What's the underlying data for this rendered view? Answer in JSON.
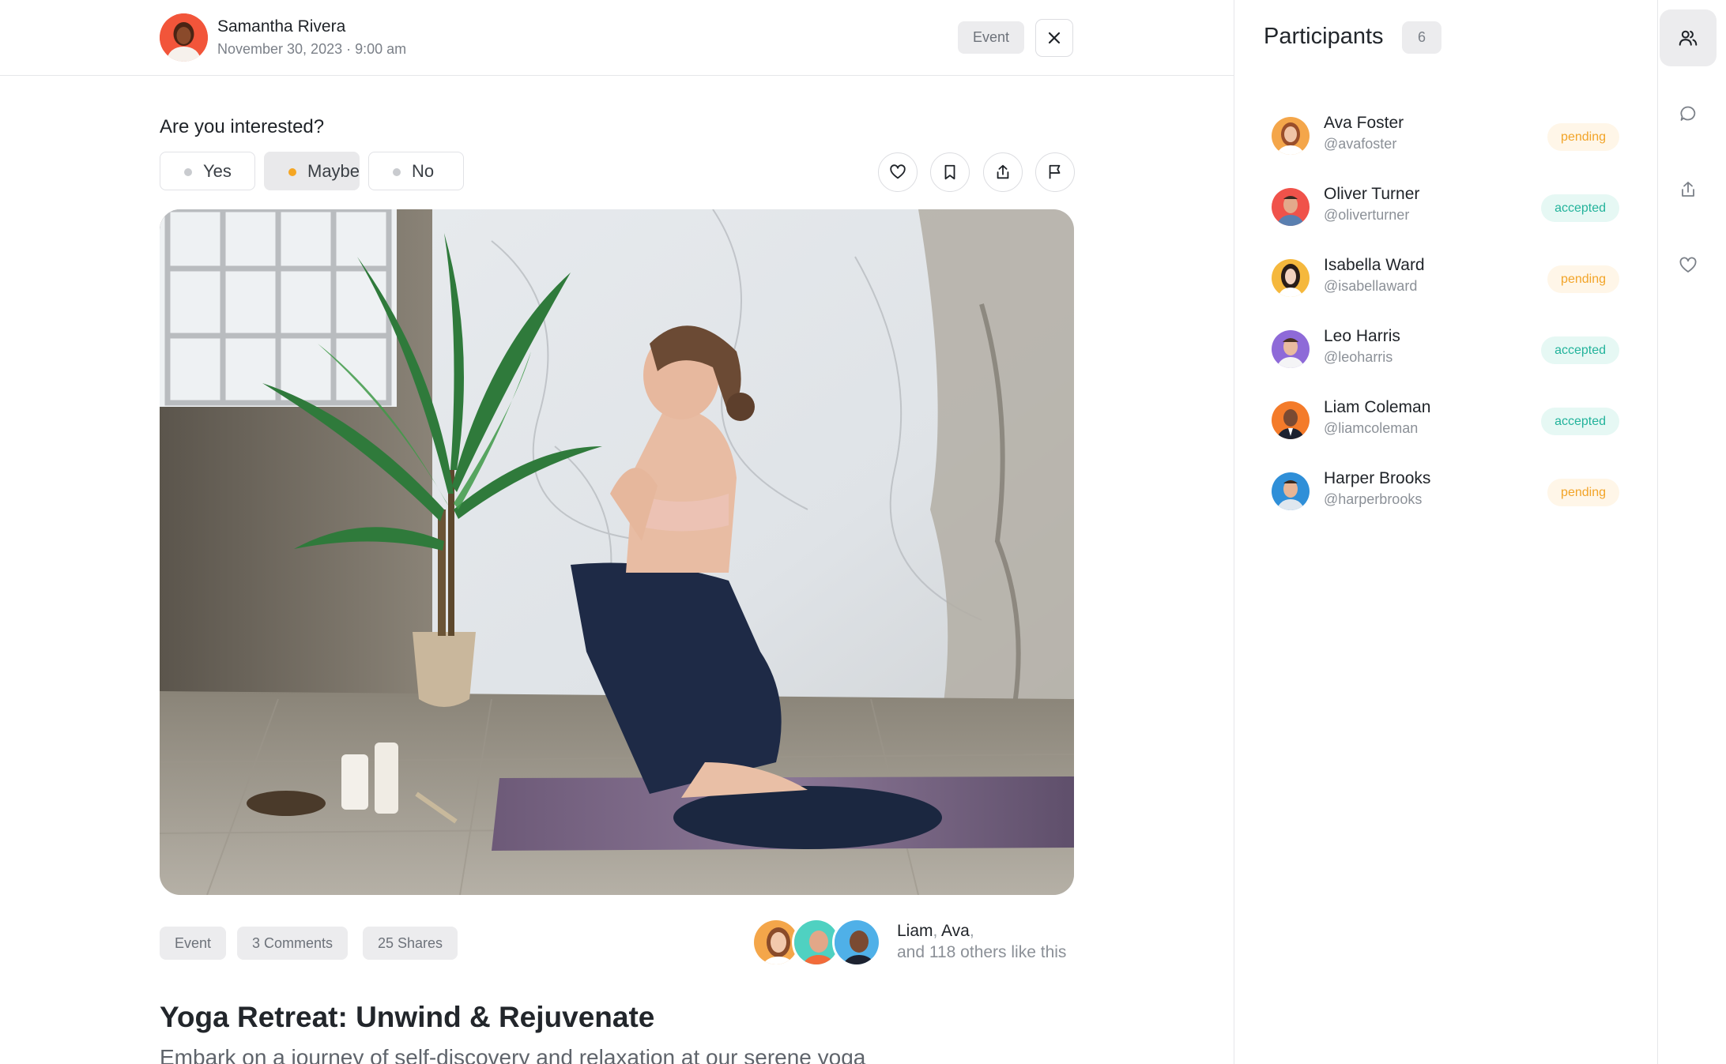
{
  "author": {
    "name": "Samantha Rivera",
    "date": "November 30, 2023 · 9:00 am"
  },
  "header": {
    "type_tag": "Event",
    "close_icon": "close-icon"
  },
  "rsvp": {
    "question": "Are you interested?",
    "options": [
      {
        "label": "Yes",
        "selected": false
      },
      {
        "label": "Maybe",
        "selected": true
      },
      {
        "label": "No",
        "selected": false
      }
    ],
    "selected_color": "#f5a623"
  },
  "actions": [
    "heart-icon",
    "bookmark-icon",
    "share-icon",
    "flag-icon"
  ],
  "post": {
    "chips": [
      "Event",
      "3 Comments",
      "25 Shares"
    ],
    "likes_names": [
      "Liam",
      "Ava"
    ],
    "likes_others": "and 118 others like this",
    "title": "Yoga Retreat: Unwind & Rejuvenate",
    "description": "Embark on a journey of self-discovery and relaxation at our serene yoga"
  },
  "participants": {
    "title": "Participants",
    "count": "6",
    "list": [
      {
        "name": "Ava Foster",
        "handle": "@avafoster",
        "status": "pending"
      },
      {
        "name": "Oliver Turner",
        "handle": "@oliverturner",
        "status": "accepted"
      },
      {
        "name": "Isabella Ward",
        "handle": "@isabellaward",
        "status": "pending"
      },
      {
        "name": "Leo Harris",
        "handle": "@leoharris",
        "status": "accepted"
      },
      {
        "name": "Liam Coleman",
        "handle": "@liamcoleman",
        "status": "accepted"
      },
      {
        "name": "Harper Brooks",
        "handle": "@harperbrooks",
        "status": "pending"
      }
    ],
    "colors": {
      "pending": "#f2a428",
      "accepted": "#23b39b"
    }
  },
  "rail": [
    "users-icon",
    "chat-icon",
    "share-icon",
    "heart-icon"
  ]
}
